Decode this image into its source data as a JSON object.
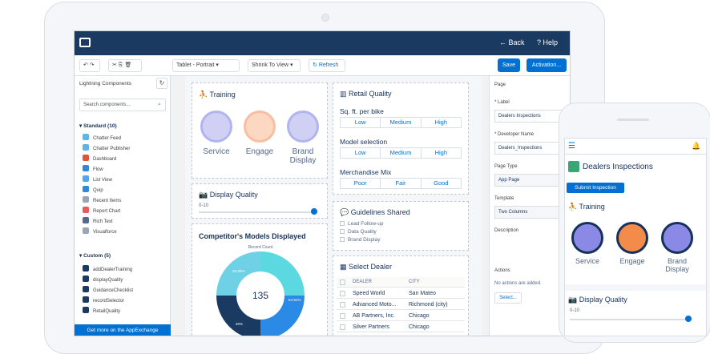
{
  "topbar": {
    "back": "← Back",
    "help": "? Help"
  },
  "toolbar": {
    "device": "Tablet - Portrait",
    "zoom": "Shrink To View",
    "refresh": "Refresh",
    "save": "Save",
    "activation": "Activation..."
  },
  "left": {
    "header": "Lightning Components",
    "search_placeholder": "Search components...",
    "standard_title": "Standard (10)",
    "standard": [
      "Chatter Feed",
      "Chatter Publisher",
      "Dashboard",
      "Flow",
      "List View",
      "Quip",
      "Recent Items",
      "Report Chart",
      "Rich Text",
      "Visualforce"
    ],
    "custom_title": "Custom (5)",
    "custom": [
      "addDealerTraining",
      "displayQuality",
      "GuidanceChecklist",
      "recordSelector",
      "RetailQuality"
    ],
    "appexchange": "Get more on the AppExchange"
  },
  "training": {
    "title": "Training",
    "items": [
      "Service",
      "Engage",
      "Brand\nDisplay"
    ]
  },
  "display_quality": {
    "title": "Display Quality",
    "range": "0-10",
    "value": 1
  },
  "competitor": {
    "title": "Competitor's Models Displayed",
    "subtitle": "Record Count",
    "center": "135",
    "labels": [
      "25-35%",
      "54-81%",
      "20%"
    ]
  },
  "retail": {
    "title": "Retail Quality",
    "sqft_label": "Sq. ft. per bike",
    "model_label": "Model selection",
    "merch_label": "Merchandise Mix",
    "lmh": [
      "Low",
      "Medium",
      "High"
    ],
    "pfg": [
      "Poor",
      "Fair",
      "Good"
    ]
  },
  "guidelines": {
    "title": "Guidelines Shared",
    "items": [
      "Lead Follow-up",
      "Data Quality",
      "Brand Display"
    ]
  },
  "dealer": {
    "title": "Select Dealer",
    "cols": [
      "DEALER",
      "CITY"
    ],
    "rows": [
      [
        "Speed World",
        "San Mateo"
      ],
      [
        "Advanced Moto...",
        "Richmond (city)"
      ],
      [
        "AB Partners, Inc.",
        "Chicago"
      ],
      [
        "Silver Partners",
        "Chicago"
      ]
    ]
  },
  "props": {
    "page": "Page",
    "label_lbl": "Label",
    "label_val": "Dealers Inspections",
    "dev_lbl": "Developer Name",
    "dev_val": "Dealers_Inspections",
    "type_lbl": "Page Type",
    "type_val": "App Page",
    "tpl_lbl": "Template",
    "tpl_val": "Two Columns",
    "desc_lbl": "Description",
    "actions_lbl": "Actions",
    "no_actions": "No actions are added.",
    "select": "Select..."
  },
  "phone": {
    "title": "Dealers Inspections",
    "submit": "Submit Inspection",
    "training": "Training",
    "items": [
      "Service",
      "Engage",
      "Brand\nDisplay"
    ],
    "dq": "Display Quality",
    "range": "0-10"
  },
  "colors": {
    "navy": "#1b3a62",
    "blue": "#0070d2",
    "purple": "#8a8ae6",
    "orange": "#f38b4a",
    "lightblue": "#5cd8e0"
  }
}
